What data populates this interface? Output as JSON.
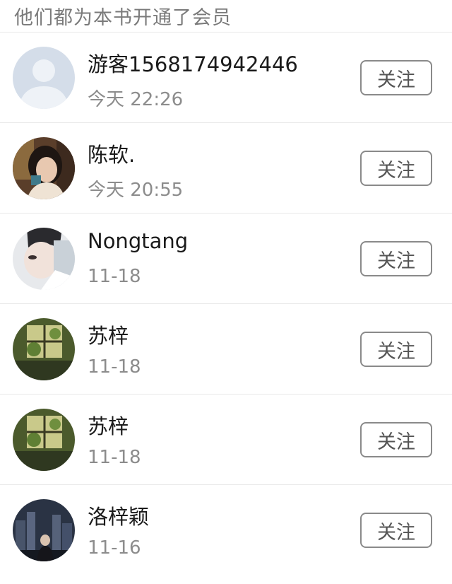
{
  "header": {
    "title": "他们都为本书开通了会员"
  },
  "members": [
    {
      "name": "游客1568174942446",
      "time": "今天 22:26",
      "follow_label": "关注",
      "avatar": "default-user-avatar"
    },
    {
      "name": "陈软.",
      "time": "今天 20:55",
      "follow_label": "关注",
      "avatar": "photo-avatar"
    },
    {
      "name": "Nongtang",
      "time": "11-18",
      "follow_label": "关注",
      "avatar": "photo-avatar"
    },
    {
      "name": "苏梓",
      "time": "11-18",
      "follow_label": "关注",
      "avatar": "photo-avatar"
    },
    {
      "name": "苏梓",
      "time": "11-18",
      "follow_label": "关注",
      "avatar": "photo-avatar"
    },
    {
      "name": "洛梓颖",
      "time": "11-16",
      "follow_label": "关注",
      "avatar": "photo-avatar"
    }
  ],
  "colors": {
    "header_text": "#7a7a7a",
    "name_text": "#1a1a1a",
    "time_text": "#8c8c8c",
    "button_border": "#8a8a8a",
    "divider": "#e9e9e9"
  }
}
